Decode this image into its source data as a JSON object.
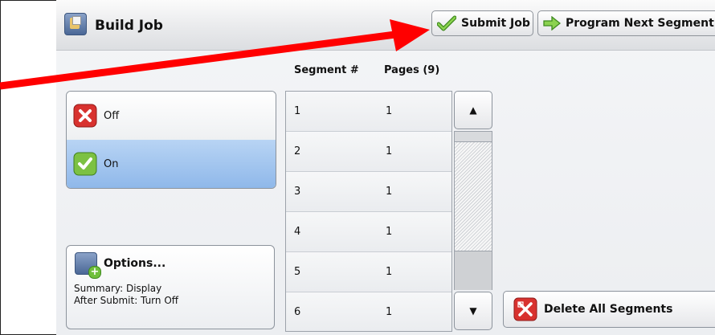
{
  "header": {
    "title": "Build Job",
    "submit_label": "Submit Job",
    "next_label": "Program Next Segment"
  },
  "toggle": {
    "off_label": "Off",
    "on_label": "On",
    "selected": "On"
  },
  "table": {
    "columns": [
      "Segment #",
      "Pages (9)"
    ],
    "rows": [
      {
        "segment": "1",
        "pages": "1"
      },
      {
        "segment": "2",
        "pages": "1"
      },
      {
        "segment": "3",
        "pages": "1"
      },
      {
        "segment": "4",
        "pages": "1"
      },
      {
        "segment": "5",
        "pages": "1"
      },
      {
        "segment": "6",
        "pages": "1"
      }
    ]
  },
  "options": {
    "label": "Options...",
    "summary_line1": "Summary: Display",
    "summary_line2": "After Submit: Turn Off"
  },
  "delete_label": "Delete All Segments",
  "icons": {
    "title": "build-job-icon",
    "submit": "checkmark-icon",
    "next": "green-arrow-icon",
    "off": "red-x-icon",
    "on": "green-check-icon",
    "options": "options-plus-icon",
    "delete": "delete-x-icon",
    "scroll_up": "up-triangle-icon",
    "scroll_down": "down-triangle-icon"
  },
  "colors": {
    "selected_bg": "#9cc3f0",
    "annotation_arrow": "#ff0000"
  }
}
